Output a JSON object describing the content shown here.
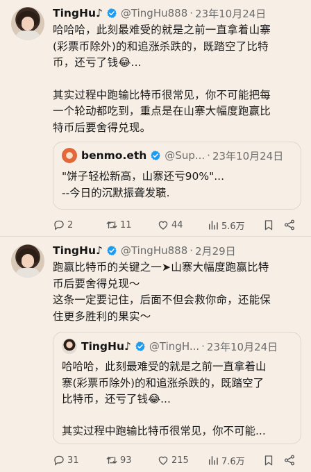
{
  "tweet1": {
    "name": "TingHu♪",
    "handle": "@TingHu888",
    "sep": "·",
    "date": "23年10月24日",
    "body": [
      "哈哈哈，此刻最难受的就是之前一直拿着山寨",
      "(彩票币除外)的和追涨杀跌的，既踏空了比特",
      "币，还亏了钱😂..."
    ],
    "body2": [
      "其实过程中跑输比特币很常见，你不可能把每",
      "一个轮动都吃到，重点是在山寨大幅度跑赢比",
      "特币后要舍得兑现。"
    ],
    "quote": {
      "name": "benmo.eth",
      "handle": "@Sup...",
      "sep": "·",
      "date": "23年10月24日",
      "lines": [
        "\"饼子轻松新高，山寨还亏90%\"...",
        "--今日的沉默振聋发聩."
      ]
    },
    "stats": {
      "replies": "2",
      "retweets": "11",
      "likes": "44",
      "views": "5.6万"
    }
  },
  "tweet2": {
    "name": "TingHu♪",
    "handle": "@TingHu888",
    "sep": "·",
    "date": "2月29日",
    "body": [
      "跑赢比特币的关键之一➤山寨大幅度跑赢比特",
      "币后要舍得兑现～",
      "这条一定要记住，后面不但会救你命，还能保",
      "住更多胜利的果实～"
    ],
    "quote": {
      "name": "TingHu♪",
      "handle": "@TingH...",
      "sep": "·",
      "date": "23年10月24日",
      "lines": [
        "哈哈哈，此刻最难受的就是之前一直拿着山",
        "寨(彩票币除外)的和追涨杀跌的，既踏空了",
        "比特币，还亏了钱😂..."
      ],
      "lines2": [
        "其实过程中跑输比特币很常见，你不可能..."
      ]
    },
    "stats": {
      "replies": "31",
      "retweets": "93",
      "likes": "215",
      "views": "7.6万"
    }
  },
  "colors": {
    "background": "#f7efe6",
    "verified": "#1d9bf0",
    "muted": "#6b6b6b"
  },
  "icons": [
    "verified-badge-icon",
    "reply-icon",
    "retweet-icon",
    "like-icon",
    "views-icon",
    "bookmark-icon",
    "share-icon"
  ]
}
